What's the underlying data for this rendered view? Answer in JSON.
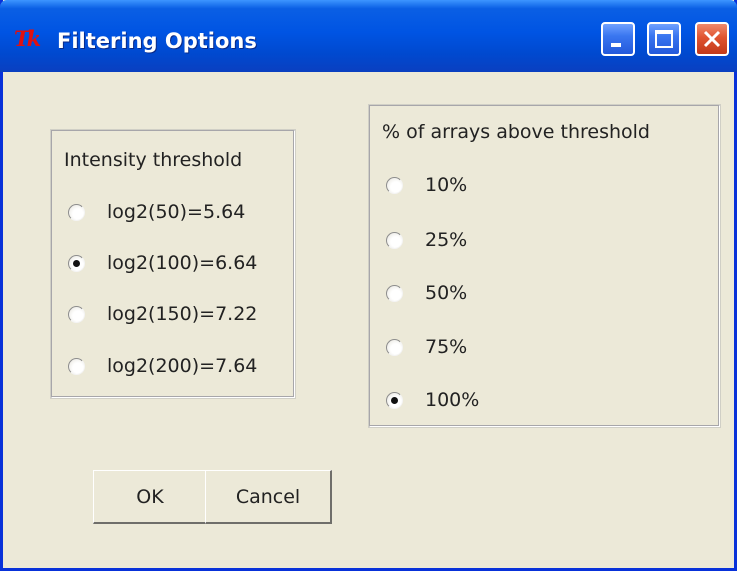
{
  "window": {
    "title": "Filtering Options",
    "app_icon_text": "Tk",
    "controls": [
      "minimize-icon",
      "maximize-icon",
      "close-icon"
    ]
  },
  "intensity_group": {
    "title": "Intensity threshold",
    "options": [
      {
        "label": "log2(50)=5.64",
        "checked": false
      },
      {
        "label": "log2(100)=6.64",
        "checked": true
      },
      {
        "label": "log2(150)=7.22",
        "checked": false
      },
      {
        "label": "log2(200)=7.64",
        "checked": false
      }
    ]
  },
  "arrays_group": {
    "title": "% of arrays above threshold",
    "options": [
      {
        "label": "10%",
        "checked": false
      },
      {
        "label": "25%",
        "checked": false
      },
      {
        "label": "50%",
        "checked": false
      },
      {
        "label": "75%",
        "checked": false
      },
      {
        "label": "100%",
        "checked": true
      }
    ]
  },
  "buttons": {
    "ok_label": "OK",
    "cancel_label": "Cancel"
  },
  "colors": {
    "titlebar": "#0054e3",
    "dialog_bg": "#ece9d8",
    "close_button": "#e05430"
  }
}
